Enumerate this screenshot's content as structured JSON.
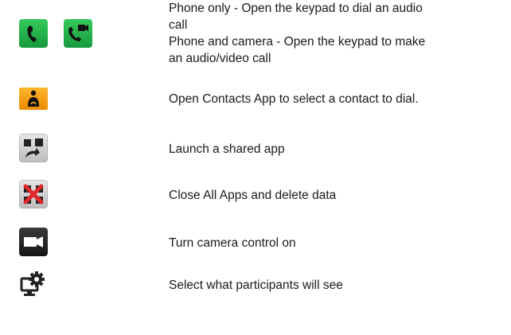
{
  "rows": [
    {
      "icons": [
        "phone-handset-icon",
        "video-call-icon"
      ],
      "lines": [
        "Phone only - Open the keypad to dial an audio",
        "call",
        "Phone and camera - Open the keypad to make",
        "an audio/video call"
      ]
    },
    {
      "icons": [
        "contacts-person-icon"
      ],
      "lines": [
        "Open Contacts App to select a contact to dial."
      ]
    },
    {
      "icons": [
        "shared-app-icon"
      ],
      "lines": [
        "Launch a shared app"
      ]
    },
    {
      "icons": [
        "close-all-apps-icon"
      ],
      "lines": [
        "Close All Apps and delete data"
      ]
    },
    {
      "icons": [
        "camera-control-icon"
      ],
      "lines": [
        "Turn camera control on"
      ]
    },
    {
      "icons": [
        "participant-view-settings-icon"
      ],
      "lines": [
        "Select what participants will see"
      ]
    }
  ],
  "colors": {
    "phone_green": "#1fb34a",
    "contacts_orange": "#f59a0c",
    "gray_tile": "#d3d3d3",
    "dark_tile": "#2a2a2a",
    "red_x": "#e0282b"
  }
}
